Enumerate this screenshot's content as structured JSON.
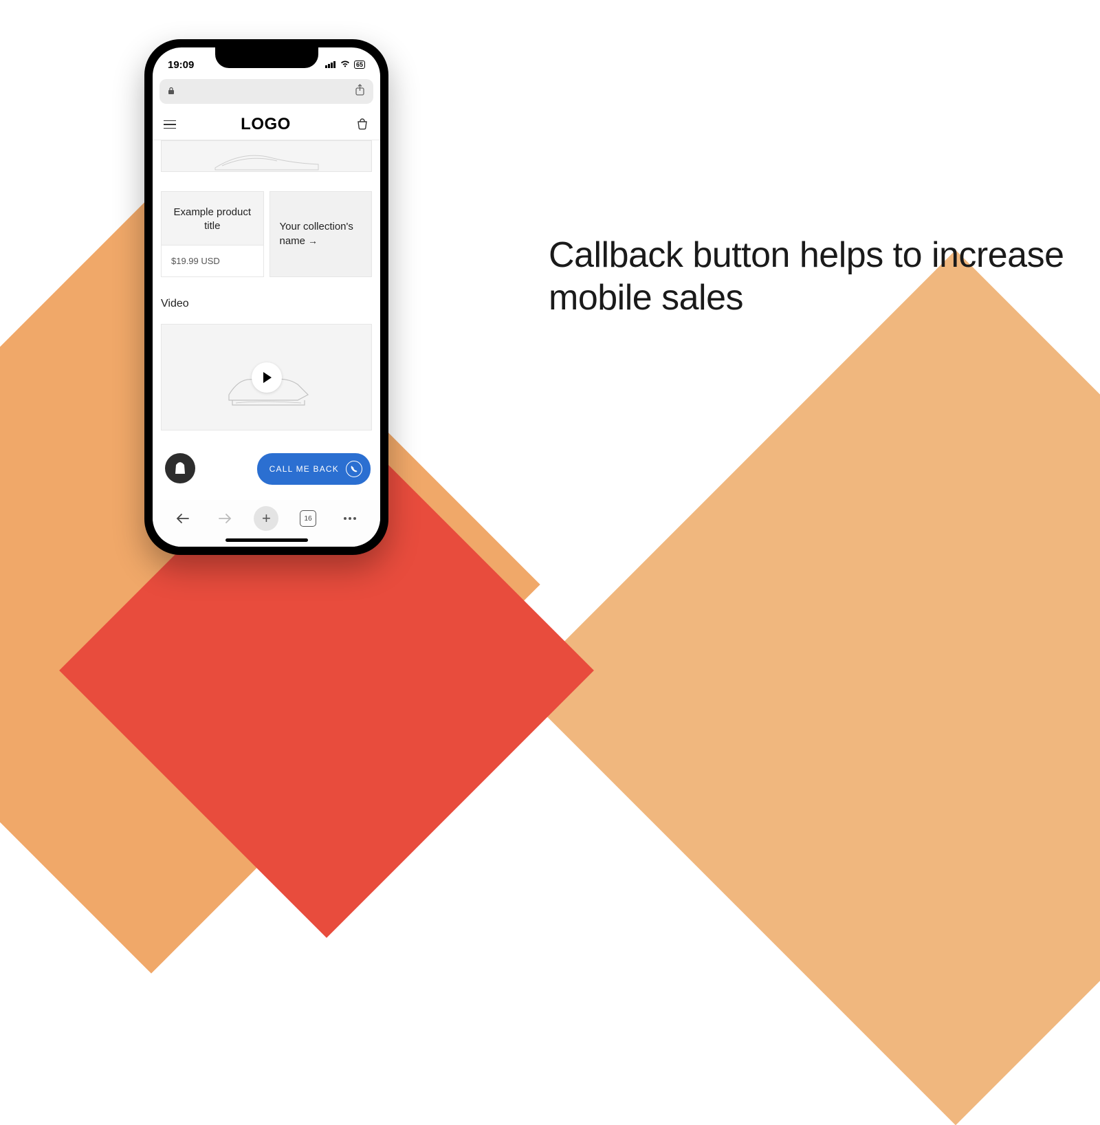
{
  "headline": "Callback button helps to increase mobile sales",
  "status": {
    "time": "19:09",
    "battery": "65"
  },
  "store": {
    "logo": "LOGO",
    "product_title": "Example product title",
    "product_price": "$19.99 USD",
    "collection_label": "Your collection's name",
    "video_label": "Video"
  },
  "callback": {
    "label": "CALL ME BACK"
  },
  "safari": {
    "tabs": "16"
  }
}
